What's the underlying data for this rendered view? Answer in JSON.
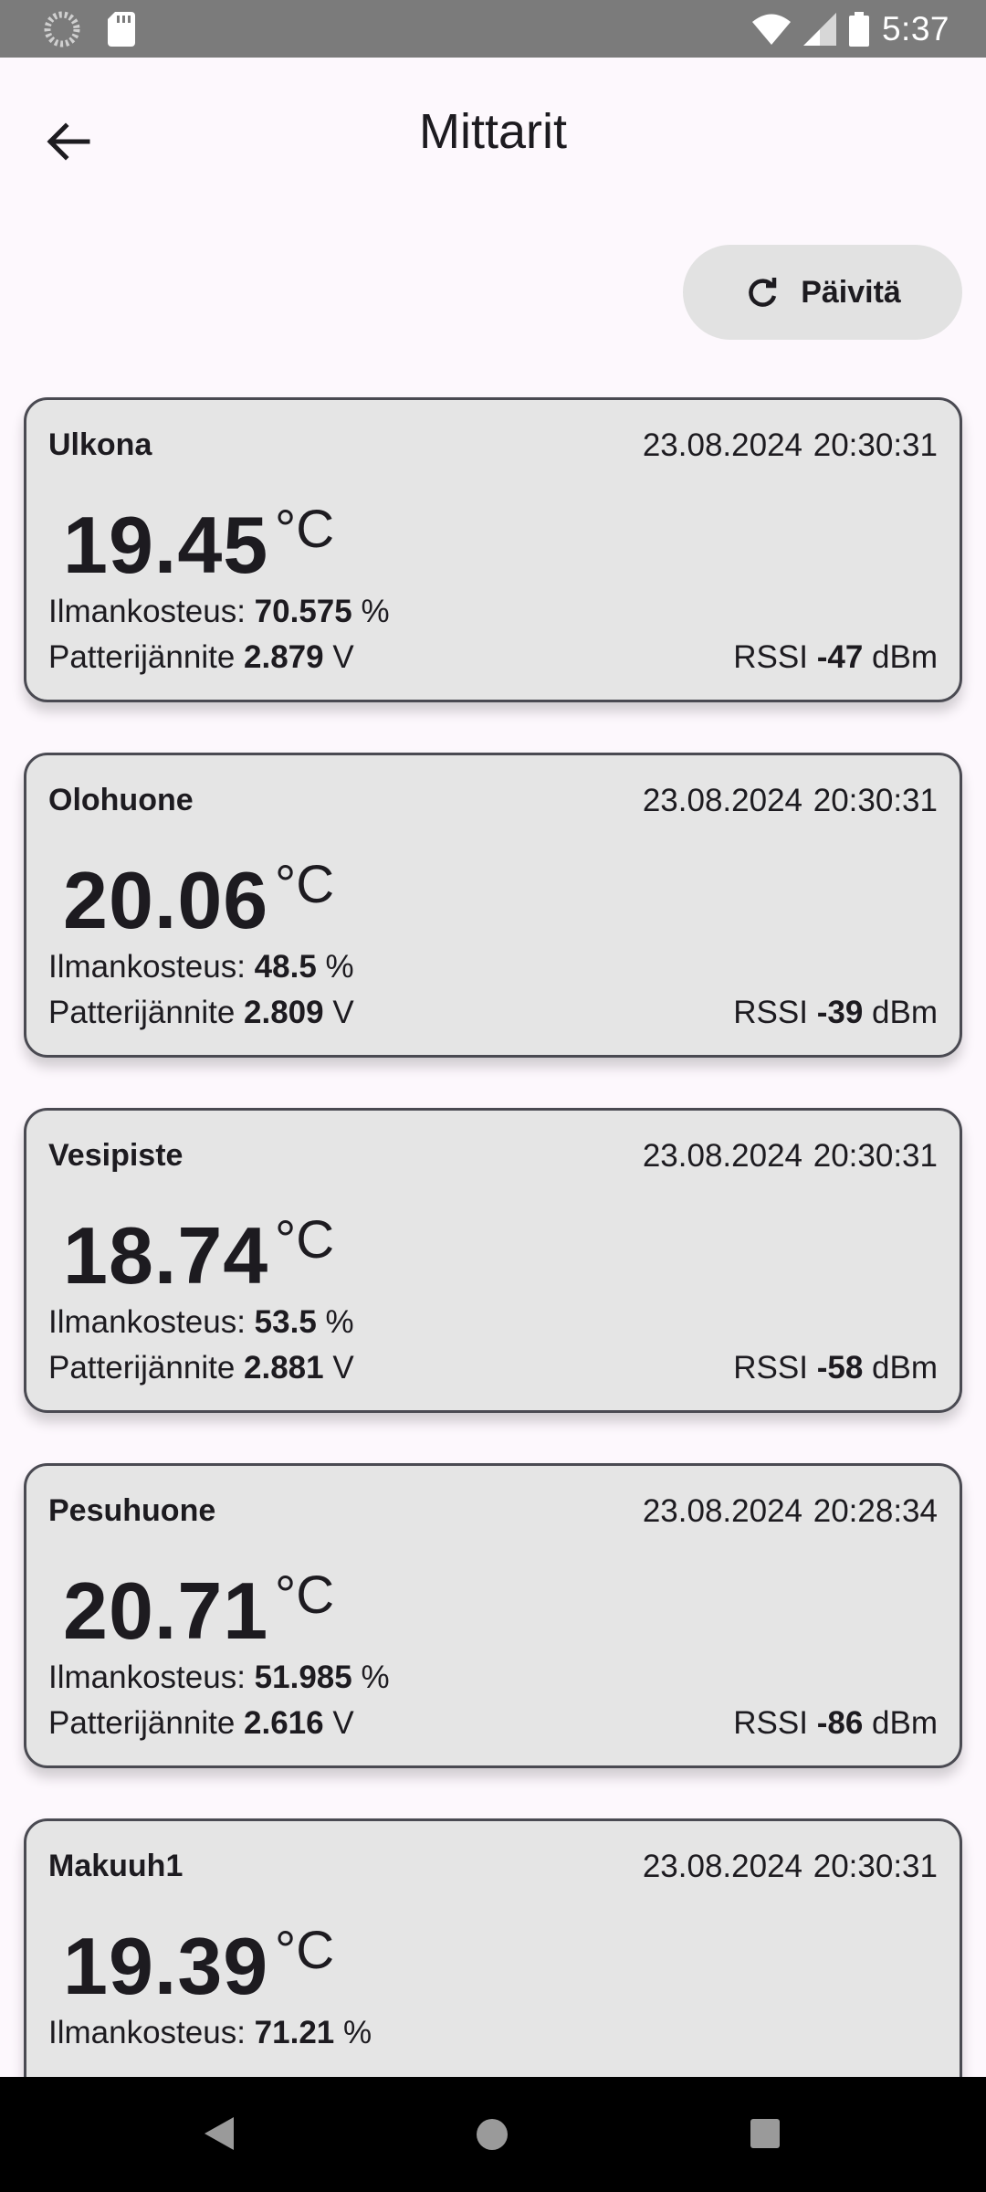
{
  "status_bar": {
    "time": "5:37",
    "icons": [
      "loading-icon",
      "sd-card-icon",
      "wifi-icon",
      "signal-icon",
      "battery-icon"
    ]
  },
  "app_bar": {
    "title": "Mittarit",
    "back_icon": "arrow-back-icon"
  },
  "refresh_button": {
    "label": "Päivitä",
    "icon": "refresh-icon"
  },
  "labels": {
    "humidity": "Ilmankosteus:",
    "battery": "Patterijännite",
    "rssi": "RSSI",
    "temp_unit": "°C",
    "humidity_unit": "%",
    "battery_unit": "V",
    "rssi_unit": "dBm"
  },
  "sensors": [
    {
      "name": "Ulkona",
      "date": "23.08.2024",
      "time": "20:30:31",
      "temperature": "19.45",
      "humidity": "70.575",
      "battery": "2.879",
      "rssi": "-47"
    },
    {
      "name": "Olohuone",
      "date": "23.08.2024",
      "time": "20:30:31",
      "temperature": "20.06",
      "humidity": "48.5",
      "battery": "2.809",
      "rssi": "-39"
    },
    {
      "name": "Vesipiste",
      "date": "23.08.2024",
      "time": "20:30:31",
      "temperature": "18.74",
      "humidity": "53.5",
      "battery": "2.881",
      "rssi": "-58"
    },
    {
      "name": "Pesuhuone",
      "date": "23.08.2024",
      "time": "20:28:34",
      "temperature": "20.71",
      "humidity": "51.985",
      "battery": "2.616",
      "rssi": "-86"
    },
    {
      "name": "Makuuh1",
      "date": "23.08.2024",
      "time": "20:30:31",
      "temperature": "19.39",
      "humidity": "71.21",
      "battery": "",
      "rssi": ""
    }
  ],
  "nav_bar": {
    "icons": [
      "nav-back-icon",
      "nav-home-icon",
      "nav-recents-icon"
    ]
  }
}
